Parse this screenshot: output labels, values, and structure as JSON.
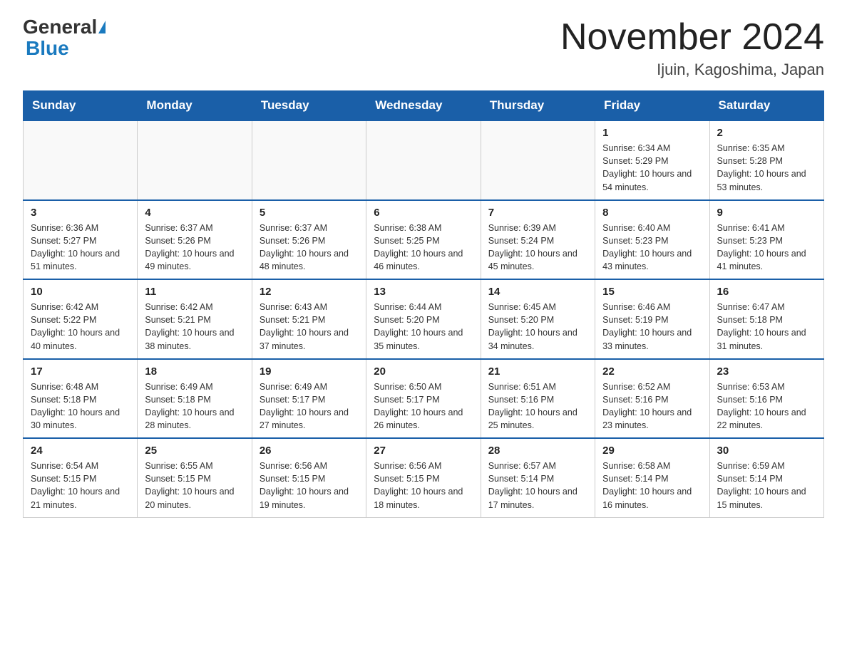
{
  "header": {
    "logo": {
      "part1": "General",
      "part2": "Blue"
    },
    "title": "November 2024",
    "subtitle": "Ijuin, Kagoshima, Japan"
  },
  "weekdays": [
    "Sunday",
    "Monday",
    "Tuesday",
    "Wednesday",
    "Thursday",
    "Friday",
    "Saturday"
  ],
  "weeks": [
    [
      {
        "day": "",
        "info": ""
      },
      {
        "day": "",
        "info": ""
      },
      {
        "day": "",
        "info": ""
      },
      {
        "day": "",
        "info": ""
      },
      {
        "day": "",
        "info": ""
      },
      {
        "day": "1",
        "info": "Sunrise: 6:34 AM\nSunset: 5:29 PM\nDaylight: 10 hours and 54 minutes."
      },
      {
        "day": "2",
        "info": "Sunrise: 6:35 AM\nSunset: 5:28 PM\nDaylight: 10 hours and 53 minutes."
      }
    ],
    [
      {
        "day": "3",
        "info": "Sunrise: 6:36 AM\nSunset: 5:27 PM\nDaylight: 10 hours and 51 minutes."
      },
      {
        "day": "4",
        "info": "Sunrise: 6:37 AM\nSunset: 5:26 PM\nDaylight: 10 hours and 49 minutes."
      },
      {
        "day": "5",
        "info": "Sunrise: 6:37 AM\nSunset: 5:26 PM\nDaylight: 10 hours and 48 minutes."
      },
      {
        "day": "6",
        "info": "Sunrise: 6:38 AM\nSunset: 5:25 PM\nDaylight: 10 hours and 46 minutes."
      },
      {
        "day": "7",
        "info": "Sunrise: 6:39 AM\nSunset: 5:24 PM\nDaylight: 10 hours and 45 minutes."
      },
      {
        "day": "8",
        "info": "Sunrise: 6:40 AM\nSunset: 5:23 PM\nDaylight: 10 hours and 43 minutes."
      },
      {
        "day": "9",
        "info": "Sunrise: 6:41 AM\nSunset: 5:23 PM\nDaylight: 10 hours and 41 minutes."
      }
    ],
    [
      {
        "day": "10",
        "info": "Sunrise: 6:42 AM\nSunset: 5:22 PM\nDaylight: 10 hours and 40 minutes."
      },
      {
        "day": "11",
        "info": "Sunrise: 6:42 AM\nSunset: 5:21 PM\nDaylight: 10 hours and 38 minutes."
      },
      {
        "day": "12",
        "info": "Sunrise: 6:43 AM\nSunset: 5:21 PM\nDaylight: 10 hours and 37 minutes."
      },
      {
        "day": "13",
        "info": "Sunrise: 6:44 AM\nSunset: 5:20 PM\nDaylight: 10 hours and 35 minutes."
      },
      {
        "day": "14",
        "info": "Sunrise: 6:45 AM\nSunset: 5:20 PM\nDaylight: 10 hours and 34 minutes."
      },
      {
        "day": "15",
        "info": "Sunrise: 6:46 AM\nSunset: 5:19 PM\nDaylight: 10 hours and 33 minutes."
      },
      {
        "day": "16",
        "info": "Sunrise: 6:47 AM\nSunset: 5:18 PM\nDaylight: 10 hours and 31 minutes."
      }
    ],
    [
      {
        "day": "17",
        "info": "Sunrise: 6:48 AM\nSunset: 5:18 PM\nDaylight: 10 hours and 30 minutes."
      },
      {
        "day": "18",
        "info": "Sunrise: 6:49 AM\nSunset: 5:18 PM\nDaylight: 10 hours and 28 minutes."
      },
      {
        "day": "19",
        "info": "Sunrise: 6:49 AM\nSunset: 5:17 PM\nDaylight: 10 hours and 27 minutes."
      },
      {
        "day": "20",
        "info": "Sunrise: 6:50 AM\nSunset: 5:17 PM\nDaylight: 10 hours and 26 minutes."
      },
      {
        "day": "21",
        "info": "Sunrise: 6:51 AM\nSunset: 5:16 PM\nDaylight: 10 hours and 25 minutes."
      },
      {
        "day": "22",
        "info": "Sunrise: 6:52 AM\nSunset: 5:16 PM\nDaylight: 10 hours and 23 minutes."
      },
      {
        "day": "23",
        "info": "Sunrise: 6:53 AM\nSunset: 5:16 PM\nDaylight: 10 hours and 22 minutes."
      }
    ],
    [
      {
        "day": "24",
        "info": "Sunrise: 6:54 AM\nSunset: 5:15 PM\nDaylight: 10 hours and 21 minutes."
      },
      {
        "day": "25",
        "info": "Sunrise: 6:55 AM\nSunset: 5:15 PM\nDaylight: 10 hours and 20 minutes."
      },
      {
        "day": "26",
        "info": "Sunrise: 6:56 AM\nSunset: 5:15 PM\nDaylight: 10 hours and 19 minutes."
      },
      {
        "day": "27",
        "info": "Sunrise: 6:56 AM\nSunset: 5:15 PM\nDaylight: 10 hours and 18 minutes."
      },
      {
        "day": "28",
        "info": "Sunrise: 6:57 AM\nSunset: 5:14 PM\nDaylight: 10 hours and 17 minutes."
      },
      {
        "day": "29",
        "info": "Sunrise: 6:58 AM\nSunset: 5:14 PM\nDaylight: 10 hours and 16 minutes."
      },
      {
        "day": "30",
        "info": "Sunrise: 6:59 AM\nSunset: 5:14 PM\nDaylight: 10 hours and 15 minutes."
      }
    ]
  ]
}
